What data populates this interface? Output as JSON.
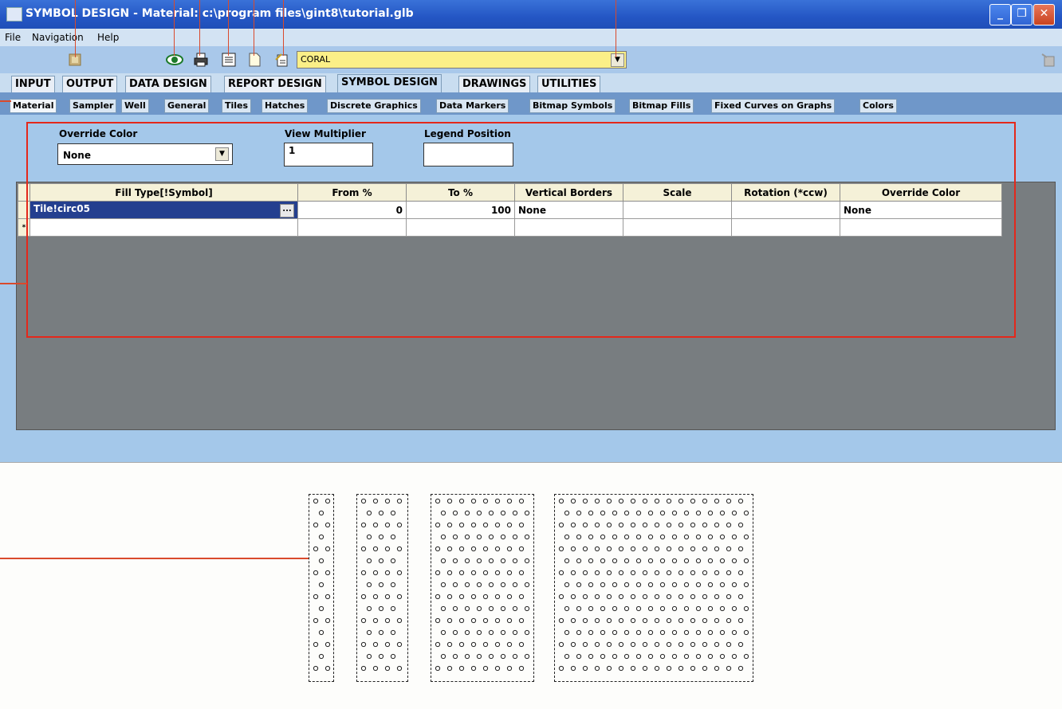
{
  "window": {
    "title": "SYMBOL DESIGN - Material:  c:\\program files\\gint8\\tutorial.glb",
    "minimize": "_",
    "restore": "❐",
    "close": "✕"
  },
  "menu": {
    "items": [
      "File",
      "Navigation",
      "Help"
    ]
  },
  "toolbar": {
    "material_dropdown_value": "CORAL",
    "icons": [
      "exit-icon",
      "view-icon",
      "print-icon",
      "properties-icon",
      "new-document-icon",
      "notes-icon",
      "help-icon"
    ]
  },
  "main_tabs": {
    "items": [
      "INPUT",
      "OUTPUT",
      "DATA DESIGN",
      "REPORT DESIGN",
      "SYMBOL DESIGN",
      "DRAWINGS",
      "UTILITIES"
    ],
    "active": "SYMBOL DESIGN"
  },
  "sub_tabs": {
    "items": [
      "Material",
      "Sampler",
      "Well",
      "General",
      "Tiles",
      "Hatches",
      "Discrete Graphics",
      "Data Markers",
      "Bitmap Symbols",
      "Bitmap Fills",
      "Fixed Curves on Graphs",
      "Colors"
    ],
    "active": "Material"
  },
  "form": {
    "override_color_label": "Override Color",
    "override_color_value": "None",
    "view_multiplier_label": "View Multiplier",
    "view_multiplier_value": "1",
    "legend_position_label": "Legend Position",
    "legend_position_value": ""
  },
  "grid": {
    "columns": [
      "Fill Type[!Symbol]",
      "From %",
      "To %",
      "Vertical Borders",
      "Scale",
      "Rotation  (*ccw)",
      "Override  Color"
    ],
    "rows": [
      {
        "fill_type": "Tile!circ05",
        "from": "0",
        "to": "100",
        "vertical_borders": "None",
        "scale": "",
        "rotation": "",
        "override_color": "None"
      }
    ],
    "new_row_marker": "*",
    "ellipsis": "..."
  },
  "colors": {
    "titlebar": "#2456c4",
    "panel": "#a4c8ea",
    "grid_bg": "#787d80",
    "highlight_box": "#e4281b",
    "dropdown_bg": "#fbef87"
  }
}
